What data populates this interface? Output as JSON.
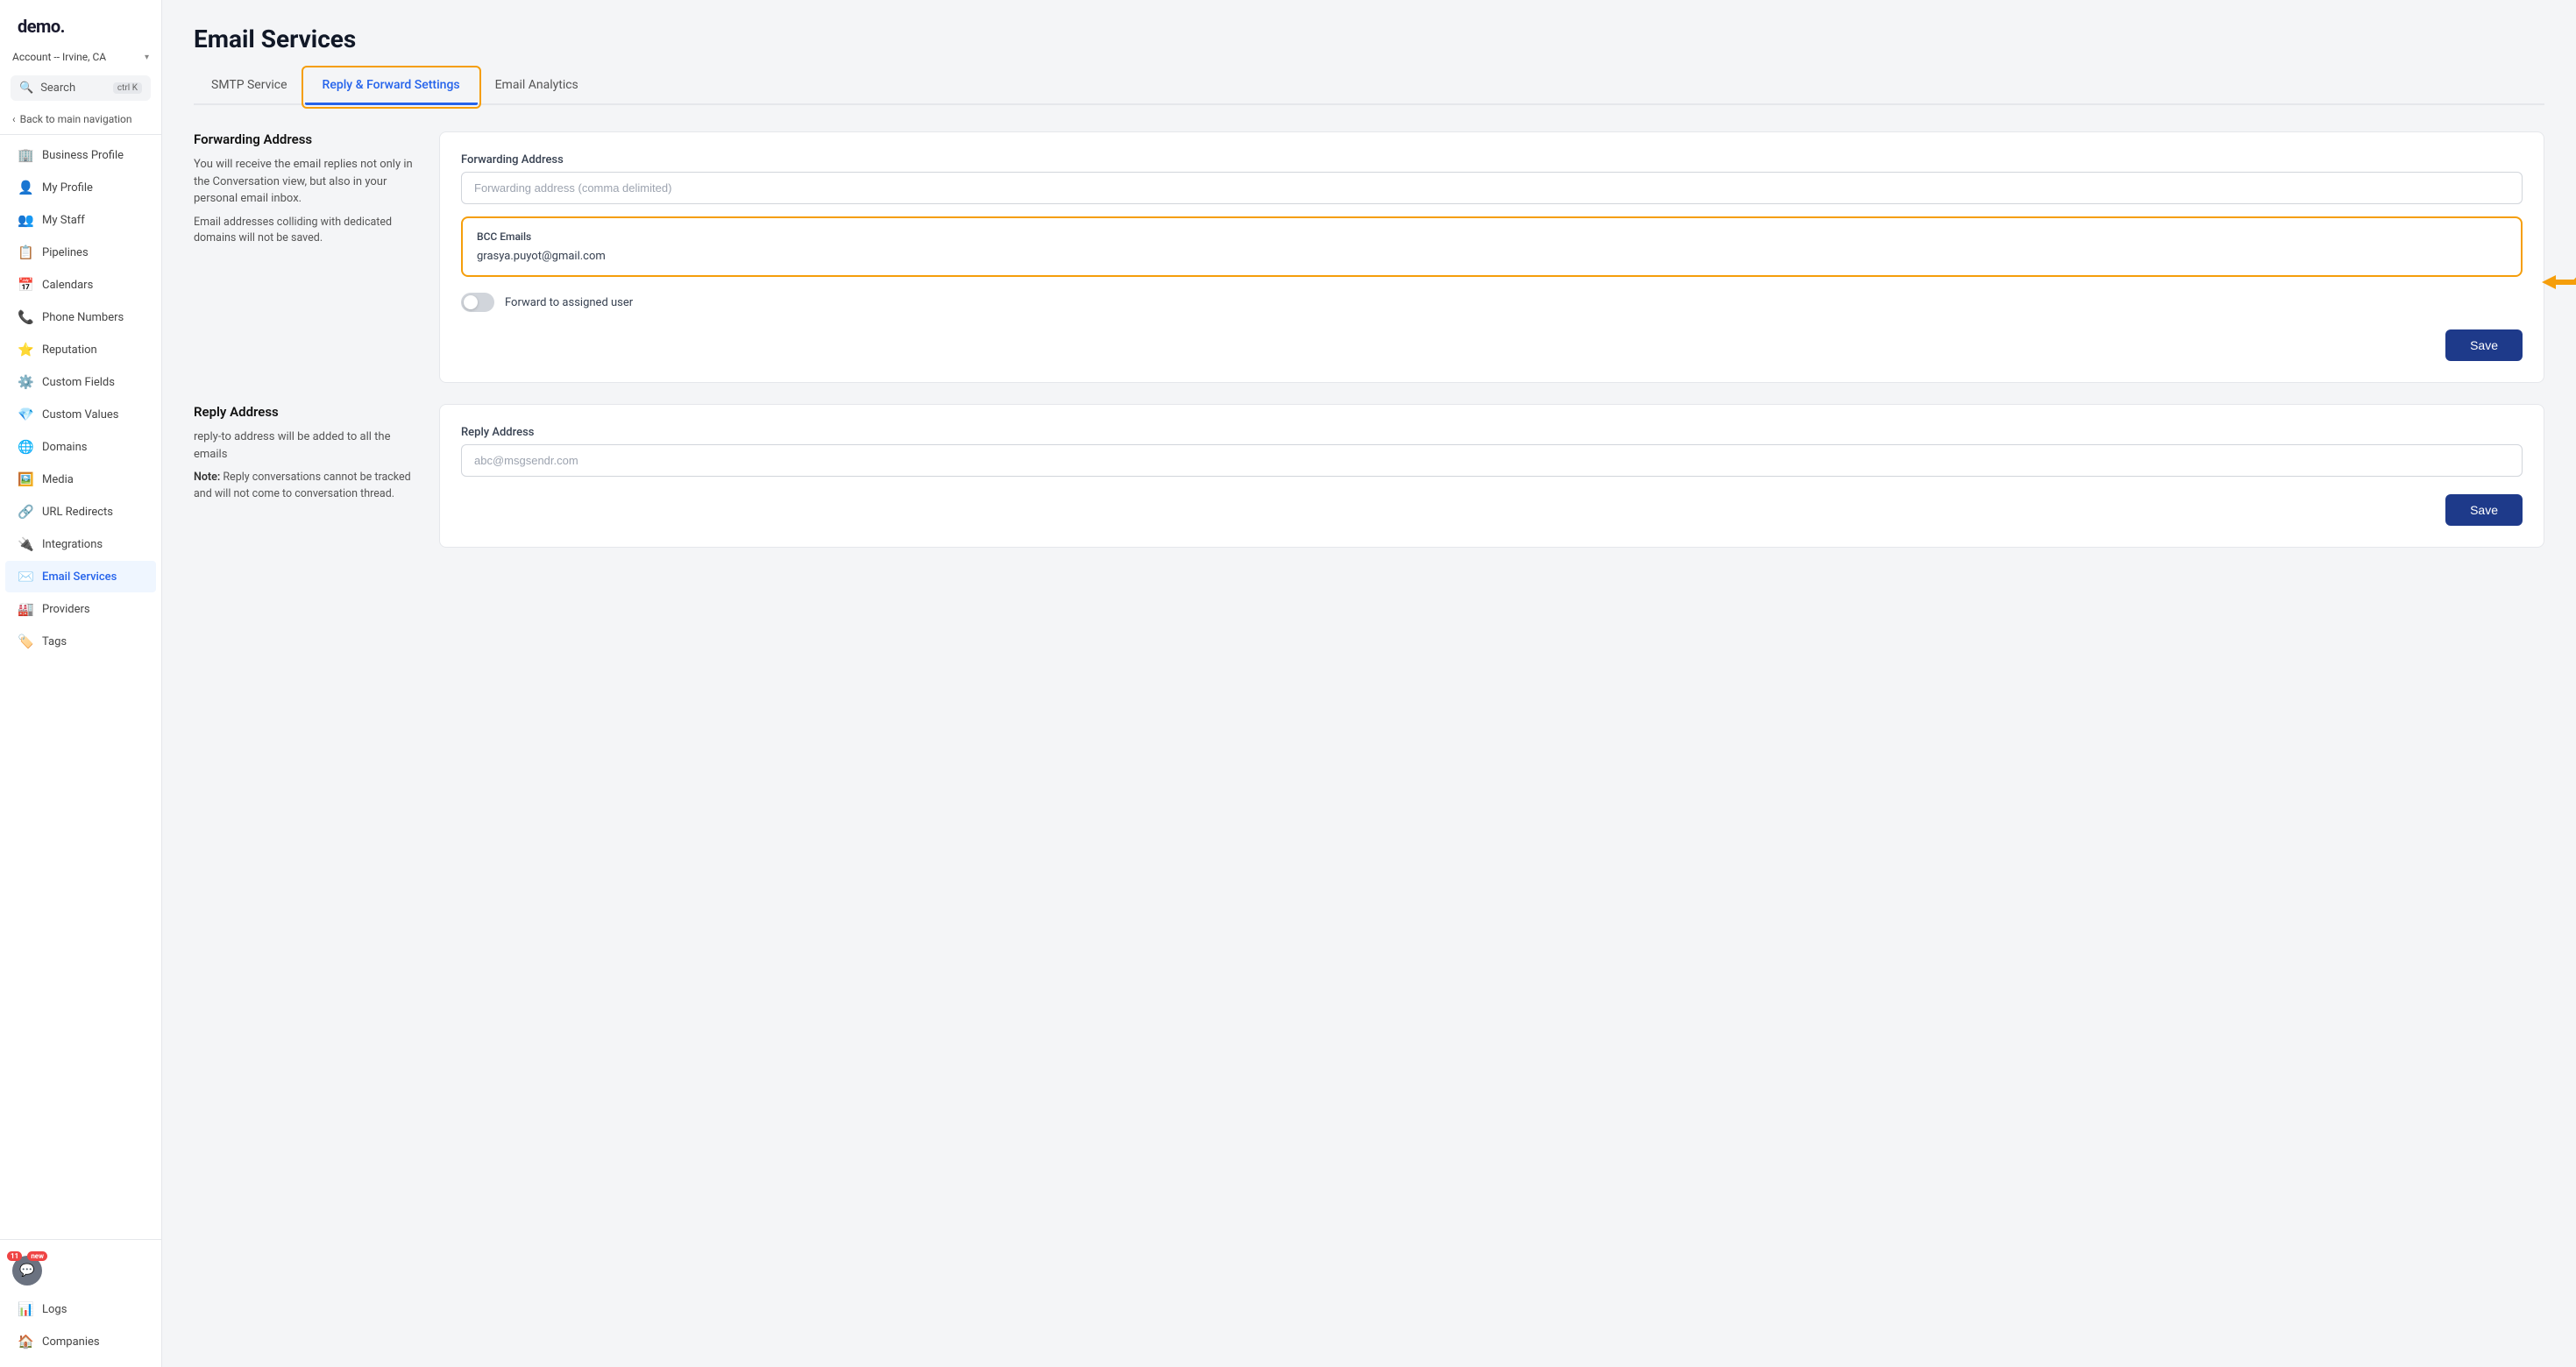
{
  "sidebar": {
    "logo": "demo.",
    "account": "Account -- Irvine, CA",
    "search_label": "Search",
    "search_shortcut": "ctrl K",
    "back_label": "Back to main navigation",
    "nav_items": [
      {
        "id": "business-profile",
        "icon": "🏢",
        "label": "Business Profile"
      },
      {
        "id": "my-profile",
        "icon": "👤",
        "label": "My Profile"
      },
      {
        "id": "my-staff",
        "icon": "👥",
        "label": "My Staff"
      },
      {
        "id": "pipelines",
        "icon": "📋",
        "label": "Pipelines"
      },
      {
        "id": "calendars",
        "icon": "📅",
        "label": "Calendars"
      },
      {
        "id": "phone-numbers",
        "icon": "📞",
        "label": "Phone Numbers"
      },
      {
        "id": "reputation",
        "icon": "⭐",
        "label": "Reputation"
      },
      {
        "id": "custom-fields",
        "icon": "⚙️",
        "label": "Custom Fields"
      },
      {
        "id": "custom-values",
        "icon": "💎",
        "label": "Custom Values"
      },
      {
        "id": "domains",
        "icon": "🌐",
        "label": "Domains"
      },
      {
        "id": "media",
        "icon": "🖼️",
        "label": "Media"
      },
      {
        "id": "url-redirects",
        "icon": "🔗",
        "label": "URL Redirects"
      },
      {
        "id": "integrations",
        "icon": "🔌",
        "label": "Integrations"
      },
      {
        "id": "email-services",
        "icon": "✉️",
        "label": "Email Services",
        "active": true
      },
      {
        "id": "providers",
        "icon": "🏭",
        "label": "Providers"
      },
      {
        "id": "tags",
        "icon": "🏷️",
        "label": "Tags"
      }
    ],
    "bottom_items": [
      {
        "id": "logs",
        "icon": "📊",
        "label": "Logs"
      },
      {
        "id": "companies",
        "icon": "🏠",
        "label": "Companies"
      }
    ]
  },
  "page": {
    "title": "Email Services",
    "tabs": [
      {
        "id": "smtp",
        "label": "SMTP Service",
        "active": false
      },
      {
        "id": "reply-forward",
        "label": "Reply & Forward Settings",
        "active": true
      },
      {
        "id": "analytics",
        "label": "Email Analytics",
        "active": false
      }
    ]
  },
  "forwarding_section": {
    "heading": "Forwarding Address",
    "description": "You will receive the email replies not only in the Conversation view, but also in your personal email inbox.",
    "note": "Email addresses colliding with dedicated domains will not be saved.",
    "card": {
      "label": "Forwarding Address",
      "placeholder": "Forwarding address (comma delimited)",
      "bcc_label": "BCC Emails",
      "bcc_value": "grasya.puyot@gmail.com",
      "toggle_label": "Forward to assigned user",
      "save_label": "Save"
    }
  },
  "reply_section": {
    "heading": "Reply Address",
    "description": "reply-to address will be added to all the emails",
    "note_prefix": "Note:",
    "note": " Reply conversations cannot be tracked and will not come to conversation thread.",
    "card": {
      "label": "Reply Address",
      "placeholder": "abc@msgsendr.com",
      "save_label": "Save"
    }
  }
}
